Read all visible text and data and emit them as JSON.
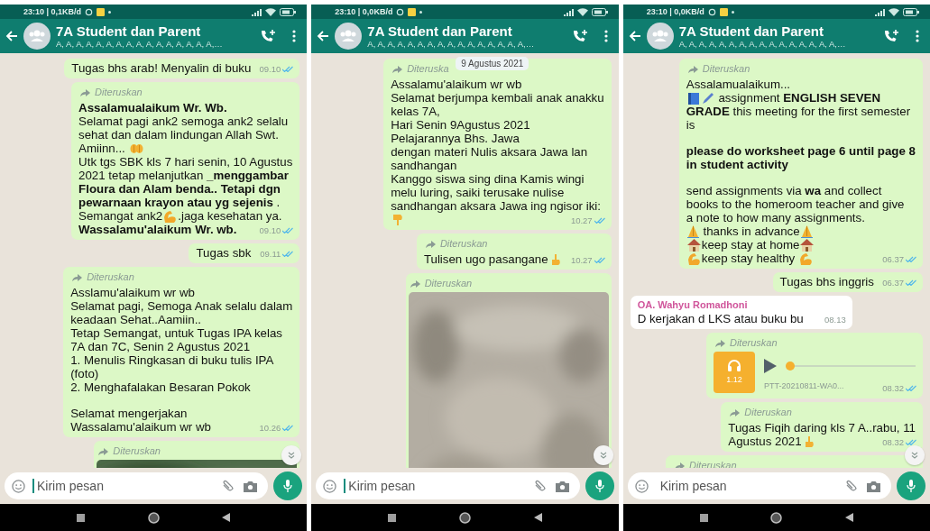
{
  "panels": [
    {
      "status_bar": {
        "time": "23:10 | 0,1KB/d"
      },
      "header": {
        "title": "7A Student dan Parent",
        "subtitle": "A, A, A, A, A, A, A, A, A, A, A, A, A, A, A, A,…"
      },
      "messages": [
        {
          "kind": "text",
          "outgoing": true,
          "paragraphs": [
            [
              [
                {
                  "kind": "text",
                  "text": "Tugas bhs arab! Menyalin di buku"
                }
              ]
            ]
          ],
          "time": "09.10"
        },
        {
          "kind": "text",
          "outgoing": true,
          "forwarded": "Diteruskan",
          "paragraphs": [
            [
              [
                {
                  "kind": "text",
                  "text": "Assalamualaikum Wr. Wb.",
                  "bold": true
                }
              ],
              [
                {
                  "kind": "text",
                  "text": "Selamat pagi ank2 semoga ank2 selalu"
                }
              ],
              [
                {
                  "kind": "text",
                  "text": "sehat dan dalam lindungan Allah Swt."
                }
              ],
              [
                {
                  "kind": "text",
                  "text": "Amiinn... "
                },
                {
                  "kind": "hands"
                }
              ],
              [
                {
                  "kind": "text",
                  "text": "Utk tgs SBK kls 7 hari senin, 10 Agustus"
                }
              ],
              [
                {
                  "kind": "text",
                  "text": "2021 tetap melanjutkan **_menggambar**"
                }
              ],
              [
                {
                  "kind": "text",
                  "text": "Floura dan Alam benda.. Tetapi dgn",
                  "bold": true
                }
              ],
              [
                {
                  "kind": "text",
                  "text": "**pewarnaan krayon atau yg sejenis** ."
                }
              ],
              [
                {
                  "kind": "text",
                  "text": "Semangat ank2"
                },
                {
                  "kind": "muscle"
                },
                {
                  "kind": "text",
                  "text": ".jaga kesehatan ya."
                }
              ],
              [
                {
                  "kind": "text",
                  "text": "Wassalamu'alaikum Wr. wb.",
                  "bold": true
                }
              ]
            ]
          ],
          "time": "09.10"
        },
        {
          "kind": "text",
          "outgoing": true,
          "paragraphs": [
            [
              [
                {
                  "kind": "text",
                  "text": "Tugas sbk"
                }
              ]
            ]
          ],
          "time": "09.11"
        },
        {
          "kind": "text",
          "outgoing": true,
          "forwarded": "Diteruskan",
          "paragraphs": [
            [
              [
                {
                  "kind": "text",
                  "text": "Asslamu'alaikum wr wb"
                }
              ],
              [
                {
                  "kind": "text",
                  "text": "Selamat pagi, Semoga Anak selalu dalam"
                }
              ],
              [
                {
                  "kind": "text",
                  "text": "keadaan Sehat..Aamiin.."
                }
              ],
              [
                {
                  "kind": "text",
                  "text": "Tetap Semangat, untuk Tugas IPA kelas"
                }
              ],
              [
                {
                  "kind": "text",
                  "text": "7A dan 7C, Senin 2 Agustus 2021"
                }
              ],
              [
                {
                  "kind": "text",
                  "text": "1. Menulis Ringkasan di buku tulis IPA"
                }
              ],
              [
                {
                  "kind": "text",
                  "text": "(foto)"
                }
              ],
              [
                {
                  "kind": "text",
                  "text": "2. Menghafalakan Besaran Pokok"
                }
              ]
            ],
            [
              [
                {
                  "kind": "text",
                  "text": "Selamat mengerjakan"
                }
              ],
              [
                {
                  "kind": "text",
                  "text": "Wassalamu'alaikum wr wb"
                }
              ]
            ]
          ],
          "time": "10.26"
        },
        {
          "outgoing": true,
          "forwarded": "Diteruskan"
        }
      ],
      "input": {
        "placeholder": "Kirim pesan",
        "focused": true
      }
    },
    {
      "status_bar": {
        "time": "23:10 | 0,0KB/d"
      },
      "header": {
        "title": "7A Student dan Parent",
        "subtitle": "A, A, A, A, A, A, A, A, A, A, A, A, A, A, A, A,…"
      },
      "date_chip": "9 Agustus 2021",
      "messages": [
        {
          "kind": "text",
          "outgoing": true,
          "forwarded": "Diteruska",
          "paragraphs": [
            [
              [
                {
                  "kind": "text",
                  "text": "Assalamu'alaikum wr wb"
                }
              ],
              [
                {
                  "kind": "text",
                  "text": "Selamat berjumpa kembali anak anakku"
                }
              ],
              [
                {
                  "kind": "text",
                  "text": "kelas 7A,"
                }
              ],
              [
                {
                  "kind": "text",
                  "text": "Hari Senin 9Agustus 2021"
                }
              ],
              [
                {
                  "kind": "text",
                  "text": "Pelajarannya Bhs. Jawa"
                }
              ],
              [
                {
                  "kind": "text",
                  "text": "dengan materi Nulis aksara Jawa lan"
                }
              ],
              [
                {
                  "kind": "text",
                  "text": "sandhangan"
                }
              ],
              [
                {
                  "kind": "text",
                  "text": "Kanggo siswa sing dina Kamis wingi"
                }
              ],
              [
                {
                  "kind": "text",
                  "text": "melu luring, saiki terusake nulise"
                }
              ],
              [
                {
                  "kind": "text",
                  "text": "sandhangan aksara Jawa ing ngisor iki:"
                }
              ],
              [
                {
                  "kind": "point-down"
                }
              ]
            ]
          ],
          "time": "10.27"
        },
        {
          "kind": "text",
          "outgoing": true,
          "forwarded": "Diteruskan",
          "paragraphs": [
            [
              [
                {
                  "kind": "text",
                  "text": "Tulisen ugo pasangane"
                },
                {
                  "kind": "point-up"
                }
              ]
            ]
          ],
          "time": "10.27"
        },
        {
          "outgoing": true,
          "forwarded": "Diteruskan"
        }
      ],
      "input": {
        "placeholder": "Kirim pesan",
        "focused": true
      }
    },
    {
      "status_bar": {
        "time": "23:10 | 0,0KB/d"
      },
      "header": {
        "title": "7A Student dan Parent",
        "subtitle": "A, A, A, A, A, A, A, A, A, A, A, A, A, A, A, A,…"
      },
      "messages": [
        {
          "kind": "text",
          "outgoing": true,
          "forwarded": "Diteruskan",
          "paragraphs": [
            [
              [
                {
                  "kind": "text",
                  "text": "Assalamualaikum..."
                }
              ],
              [
                {
                  "kind": "book"
                },
                {
                  "kind": "pen"
                },
                {
                  "kind": "text",
                  "text": " assignment **ENGLISH SEVEN**"
                }
              ],
              [
                {
                  "kind": "text",
                  "text": "**GRADE** this meeting for the first semester"
                }
              ],
              [
                {
                  "kind": "text",
                  "text": "is"
                }
              ]
            ],
            [
              [
                {
                  "kind": "text",
                  "text": "please do worksheet page 6 until page 8",
                  "bold": true
                }
              ],
              [
                {
                  "kind": "text",
                  "text": "in student activity",
                  "bold": true
                }
              ]
            ],
            [
              [
                {
                  "kind": "text",
                  "text": "send assignments via **wa** and collect"
                }
              ],
              [
                {
                  "kind": "text",
                  "text": "books to the homeroom teacher and give"
                }
              ],
              [
                {
                  "kind": "text",
                  "text": "a note to how many assignments."
                }
              ],
              [
                {
                  "kind": "pray"
                },
                {
                  "kind": "text",
                  "text": " thanks in advance"
                },
                {
                  "kind": "pray"
                }
              ],
              [
                {
                  "kind": "house"
                },
                {
                  "kind": "text",
                  "text": "keep stay at home"
                },
                {
                  "kind": "house"
                }
              ],
              [
                {
                  "kind": "muscle"
                },
                {
                  "kind": "text",
                  "text": "keep stay healthy "
                },
                {
                  "kind": "muscle"
                }
              ]
            ]
          ],
          "time": "06.37"
        },
        {
          "kind": "text",
          "outgoing": true,
          "paragraphs": [
            [
              [
                {
                  "kind": "text",
                  "text": "Tugas bhs inggris"
                }
              ]
            ]
          ],
          "time": "06.37"
        },
        {
          "kind": "text",
          "outgoing": false,
          "sender": "OA. Wahyu Romadhoni",
          "paragraphs": [
            [
              [
                {
                  "kind": "text",
                  "text": "D kerjakan d LKS atau buku bu"
                }
              ]
            ]
          ],
          "time": "08.13"
        },
        {
          "kind": "voice",
          "outgoing": true,
          "forwarded": "Diteruskan",
          "duration": "1.12",
          "filename": "PTT-20210811-WA0...",
          "level": 0,
          "time": "08.32"
        },
        {
          "kind": "text",
          "outgoing": true,
          "forwarded": "Diteruskan",
          "paragraphs": [
            [
              [
                {
                  "kind": "text",
                  "text": "Tugas Fiqih daring kls 7 A..rabu, 11"
                }
              ],
              [
                {
                  "kind": "text",
                  "text": "Agustus 2021"
                },
                {
                  "kind": "point-up"
                }
              ]
            ]
          ],
          "time": "08.32"
        },
        {
          "kind": "partial",
          "outgoing": true,
          "forwarded": "Diteruskan"
        }
      ],
      "input": {
        "placeholder": "Kirim pesan",
        "focused": false
      }
    }
  ]
}
